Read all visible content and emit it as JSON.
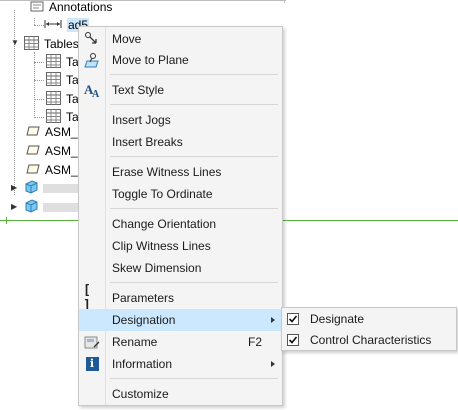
{
  "tree": {
    "annotations_label": "Annotations",
    "selected_item_label": "ad5",
    "tables_label": "Tables",
    "table_items": [
      "Ta",
      "Ta",
      "Ta",
      "Ta"
    ],
    "asm_items": [
      "ASM_I",
      "ASM_I",
      "ASM_I"
    ]
  },
  "context_menu": {
    "move": "Move",
    "move_to_plane": "Move to Plane",
    "text_style": "Text Style",
    "insert_jogs": "Insert Jogs",
    "insert_breaks": "Insert Breaks",
    "erase_witness_lines": "Erase Witness Lines",
    "toggle_to_ordinate": "Toggle To Ordinate",
    "change_orientation": "Change Orientation",
    "clip_witness_lines": "Clip Witness Lines",
    "skew_dimension": "Skew Dimension",
    "parameters": "Parameters",
    "designation": "Designation",
    "rename": "Rename",
    "rename_shortcut": "F2",
    "information": "Information",
    "customize": "Customize"
  },
  "designation_submenu": {
    "designate": {
      "label": "Designate",
      "checked": true
    },
    "control_characteristics": {
      "label": "Control Characteristics",
      "checked": true
    }
  },
  "colors": {
    "highlight": "#cce8ff",
    "green_line": "#56b33c",
    "info_icon": "#1f5a96"
  }
}
